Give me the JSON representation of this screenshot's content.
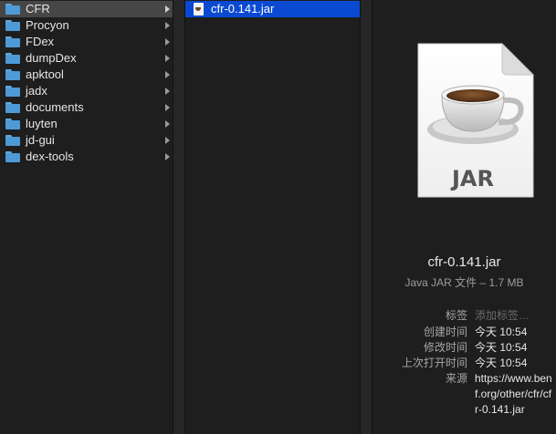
{
  "sidebar": {
    "items": [
      {
        "label": "CFR"
      },
      {
        "label": "Procyon"
      },
      {
        "label": "FDex"
      },
      {
        "label": "dumpDex"
      },
      {
        "label": "apktool"
      },
      {
        "label": "jadx"
      },
      {
        "label": "documents"
      },
      {
        "label": "luyten"
      },
      {
        "label": "jd-gui"
      },
      {
        "label": "dex-tools"
      }
    ]
  },
  "files": {
    "items": [
      {
        "label": "cfr-0.141.jar"
      }
    ]
  },
  "preview": {
    "icon_label": "JAR",
    "file_name": "cfr-0.141.jar",
    "file_kind": "Java JAR 文件 – 1.7 MB",
    "meta": {
      "tags_label": "标签",
      "tags_placeholder": "添加标签…",
      "created_label": "创建时间",
      "created_value": "今天 10:54",
      "modified_label": "修改时间",
      "modified_value": "今天 10:54",
      "opened_label": "上次打开时间",
      "opened_value": "今天 10:54",
      "source_label": "来源",
      "source_value": "https://www.benf.org/other/cfr/cfr-0.141.jar"
    }
  },
  "colors": {
    "selection_blue": "#0a4ad2",
    "selection_gray": "#464646",
    "folder_blue": "#4e9ad6"
  }
}
